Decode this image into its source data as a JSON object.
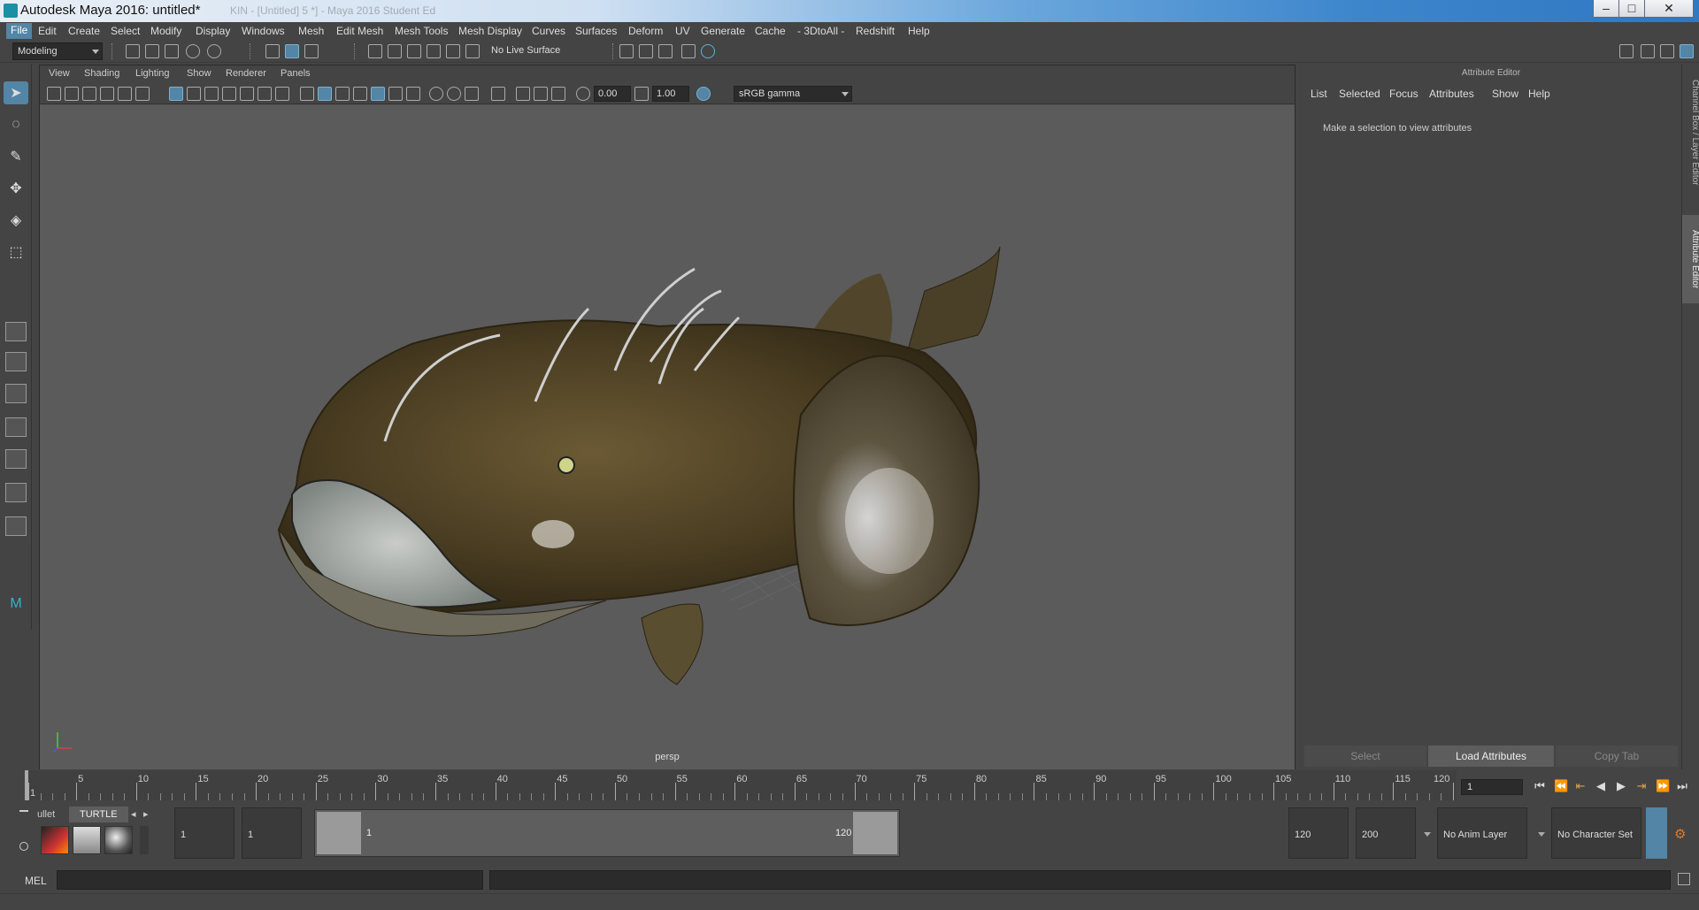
{
  "window": {
    "title": "Autodesk Maya 2016: untitled*",
    "faded_subtitle": "KIN - [Untitled] 5 *] - Maya 2016 Student Ed",
    "buttons": {
      "minimize": "–",
      "maximize": "□",
      "close": "✕"
    }
  },
  "menubar": {
    "items": [
      "File",
      "Edit",
      "Create",
      "Select",
      "Modify",
      "Display",
      "Windows",
      "Mesh",
      "Edit Mesh",
      "Mesh Tools",
      "Mesh Display",
      "Curves",
      "Surfaces",
      "Deform",
      "UV",
      "Generate",
      "Cache",
      "- 3DtoAll -",
      "Redshift",
      "Help"
    ],
    "active": "File"
  },
  "shelfbar": {
    "mode_dropdown": "Modeling",
    "live_surface": "No Live Surface"
  },
  "panel": {
    "menus": [
      "View",
      "Shading",
      "Lighting",
      "Show",
      "Renderer",
      "Panels"
    ],
    "exposure": "0.00",
    "gamma": "1.00",
    "color_space": "sRGB gamma",
    "camera": "persp"
  },
  "attribute_editor": {
    "title": "Attribute Editor",
    "menus": [
      "List",
      "Selected",
      "Focus",
      "Attributes",
      "Show",
      "Help"
    ],
    "empty_message": "Make a selection to view attributes",
    "buttons": {
      "select": "Select",
      "load": "Load Attributes",
      "copy": "Copy Tab"
    },
    "side_tabs": [
      "Channel Box / Layer Editor",
      "Attribute Editor"
    ]
  },
  "timeline": {
    "start": 1,
    "end": 120,
    "tick_labels": [
      "1",
      "5",
      "10",
      "15",
      "20",
      "25",
      "30",
      "35",
      "40",
      "45",
      "50",
      "55",
      "60",
      "65",
      "70",
      "75",
      "80",
      "85",
      "90",
      "95",
      "100",
      "105",
      "110",
      "115",
      "120"
    ],
    "current_frame": "1",
    "playback_icons": [
      "skip-to-start",
      "step-back-key",
      "step-back-frame",
      "play-back",
      "play-forward",
      "step-forward-frame",
      "skip-to-end"
    ]
  },
  "range": {
    "shelf_tabs": [
      "ullet",
      "TURTLE"
    ],
    "start_field": "1",
    "anim_start_field": "1",
    "slider_start": "1",
    "slider_end": "120",
    "anim_end_field": "120",
    "playback_end_field": "200",
    "anim_layer": "No Anim Layer",
    "character_set": "No Character Set"
  },
  "cmdline": {
    "label": "MEL"
  },
  "colors": {
    "accent": "#5285a6",
    "bg": "#444444",
    "viewport": "#5b5b5b"
  }
}
